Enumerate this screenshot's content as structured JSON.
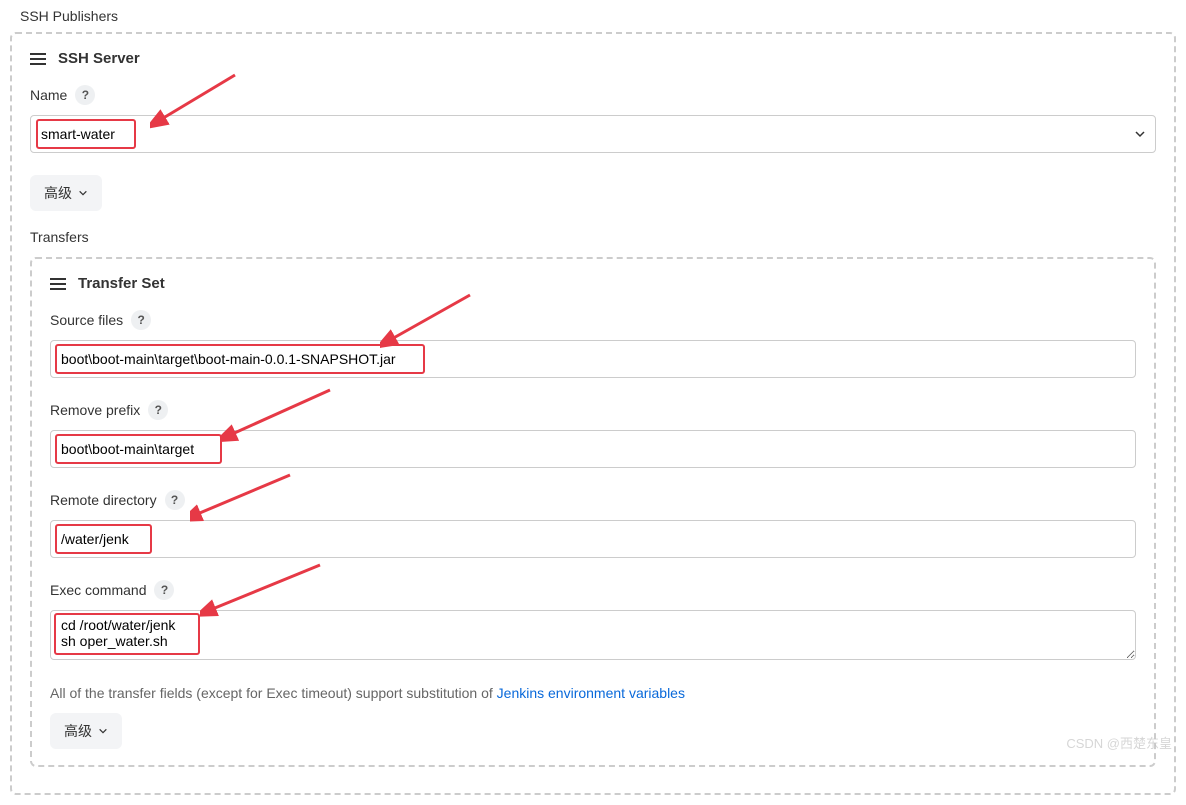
{
  "sectionTitle": "SSH Publishers",
  "sshServer": {
    "title": "SSH Server",
    "nameLabel": "Name",
    "nameValue": "smart-water",
    "advancedLabel": "高级"
  },
  "transfersLabel": "Transfers",
  "transferSet": {
    "title": "Transfer Set",
    "sourceFilesLabel": "Source files",
    "sourceFilesValue": "boot\\boot-main\\target\\boot-main-0.0.1-SNAPSHOT.jar",
    "removePrefixLabel": "Remove prefix",
    "removePrefixValue": "boot\\boot-main\\target",
    "remoteDirLabel": "Remote directory",
    "remoteDirValue": "/water/jenk",
    "execCmdLabel": "Exec command",
    "execCmdValue": "cd /root/water/jenk\nsh oper_water.sh",
    "helperPrefix": "All of the transfer fields (except for Exec timeout) support substitution of ",
    "helperLink": "Jenkins environment variables",
    "advancedLabel": "高级"
  },
  "watermark": "CSDN @西楚东皇"
}
